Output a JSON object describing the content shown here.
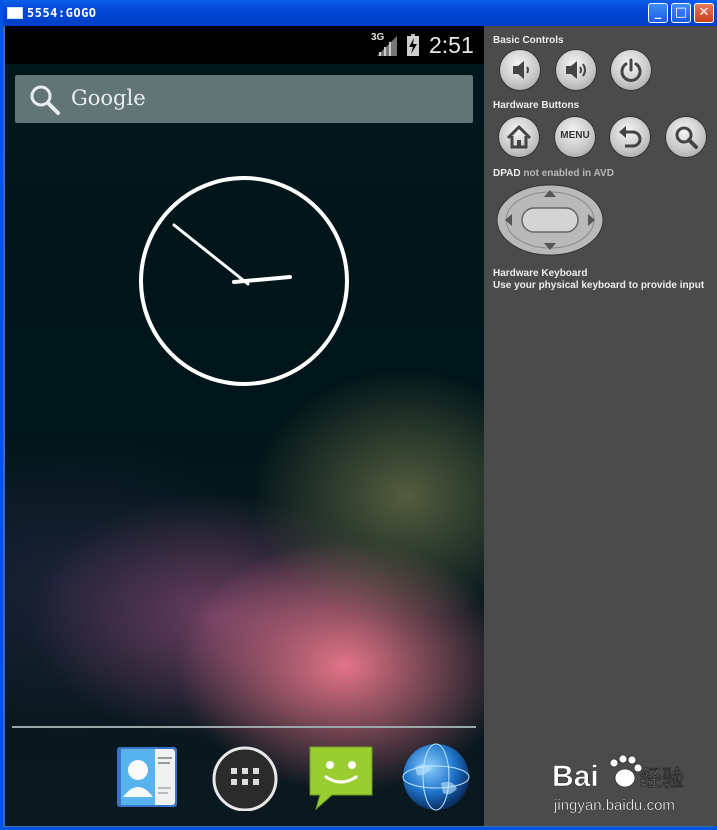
{
  "window": {
    "title": "5554:GOGO",
    "minimize_label": "_",
    "maximize_label": "□",
    "close_label": "✕"
  },
  "status_bar": {
    "network": "3G",
    "time": "2:51",
    "icons": [
      "signal-icon",
      "battery-icon"
    ]
  },
  "search_widget": {
    "label": "Google",
    "icon": "search-icon"
  },
  "clock_widget": {
    "type": "analog-clock"
  },
  "dock": {
    "items": [
      {
        "name": "contacts",
        "icon": "contacts-icon"
      },
      {
        "name": "all-apps",
        "icon": "apps-grid-icon"
      },
      {
        "name": "messaging",
        "icon": "messaging-icon"
      },
      {
        "name": "browser",
        "icon": "globe-icon"
      }
    ]
  },
  "controls_panel": {
    "basic_controls_label": "Basic Controls",
    "basic_controls": [
      "volume-down-icon",
      "volume-up-icon",
      "power-icon"
    ],
    "hardware_buttons_label": "Hardware Buttons",
    "hardware_buttons": [
      "home-icon",
      "menu",
      "back-icon",
      "search-icon"
    ],
    "menu_label": "MENU",
    "dpad_label": "DPAD",
    "dpad_status": "not enabled in AVD",
    "keyboard_title": "Hardware Keyboard",
    "keyboard_desc": "Use your physical keyboard to provide input"
  },
  "watermark": {
    "brand": "Bai",
    "brand_suffix": "经验",
    "url": "jingyan.baidu.com"
  },
  "colors": {
    "titlebar": "#0046d5",
    "panel_bg": "#4b4b4b",
    "device_bg": "#001014"
  }
}
